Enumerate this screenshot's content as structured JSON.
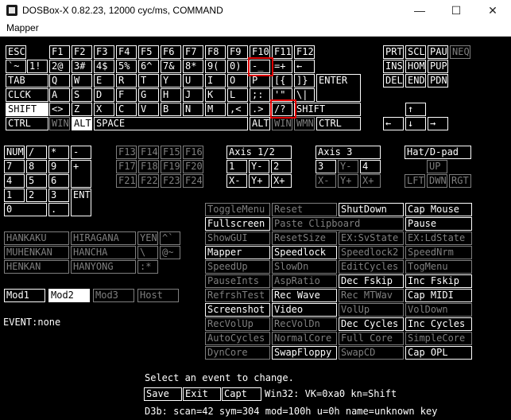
{
  "window": {
    "title": "DOSBox-X 0.82.23, 12000 cyc/ms, COMMAND",
    "minimize_glyph": "—",
    "maximize_glyph": "☐",
    "close_glyph": "✕"
  },
  "menu": [
    "Mapper"
  ],
  "keyboard": {
    "row_f": [
      "ESC",
      "F1",
      "F2",
      "F3",
      "F4",
      "F5",
      "F6",
      "F7",
      "F8",
      "F9",
      "F10",
      "F11",
      "F12"
    ],
    "row_num": [
      "`~",
      "1!",
      "2@",
      "3#",
      "4$",
      "5%",
      "6^",
      "7&",
      "8*",
      "9(",
      "0)",
      "-_",
      "=+",
      "←"
    ],
    "row_tab": [
      "TAB",
      "Q",
      "W",
      "E",
      "R",
      "T",
      "Y",
      "U",
      "I",
      "O",
      "P",
      "[{",
      "]}",
      "ENTER"
    ],
    "row_caps": [
      "CLCK",
      "A",
      "S",
      "D",
      "F",
      "G",
      "H",
      "J",
      "K",
      "L",
      ";:",
      "'\"",
      "\\|"
    ],
    "row_shift": [
      "SHIFT",
      "<>",
      "Z",
      "X",
      "C",
      "V",
      "B",
      "N",
      "M",
      ",<",
      ".>",
      "/?",
      "SHIFT"
    ],
    "row_ctrl": [
      "CTRL",
      "WIN",
      "ALT",
      "SPACE",
      "ALT",
      "WIN",
      "WMN",
      "CTRL"
    ]
  },
  "nav": {
    "row1": [
      "PRT",
      "SCL",
      "PAU",
      "NEQ"
    ],
    "row2": [
      "INS",
      "HOM",
      "PUP"
    ],
    "row3": [
      "DEL",
      "END",
      "PDN"
    ],
    "arrows": [
      "↑",
      "←",
      "↓",
      "→"
    ]
  },
  "numpad": {
    "row1": [
      "NUM",
      "/",
      "*",
      "-"
    ],
    "row2": [
      "7",
      "8",
      "9",
      "+"
    ],
    "row3": [
      "4",
      "5",
      "6"
    ],
    "row4": [
      "1",
      "2",
      "3",
      "ENT"
    ],
    "row5": [
      "0",
      "."
    ]
  },
  "fkeys_ext": [
    "F13",
    "F14",
    "F15",
    "F16",
    "F17",
    "F18",
    "F19",
    "F20",
    "F21",
    "F22",
    "F23",
    "F24"
  ],
  "axis12": {
    "title": "Axis 1/2",
    "keys": [
      "1",
      "Y-",
      "2",
      "X-",
      "Y+",
      "X+"
    ]
  },
  "axis3": {
    "title": "Axis 3",
    "keys": [
      "3",
      "Y-",
      "4",
      "X-",
      "Y+",
      "X+"
    ]
  },
  "hat": {
    "title": "Hat/D-pad",
    "keys": [
      "UP",
      "LFT",
      "DWN",
      "RGT"
    ]
  },
  "jp_keys": [
    "HANKAKU",
    "HIRAGANA",
    "YEN",
    "^`",
    "MUHENKAN",
    "HANCHA",
    "\\",
    "@~",
    "HENKAN",
    "HANYONG",
    ":*"
  ],
  "mods": [
    "Mod1",
    "Mod2",
    "Mod3",
    "Host"
  ],
  "event_status": "EVENT:none",
  "events": [
    [
      "ToggleMenu",
      "Reset",
      "ShutDown",
      "Cap Mouse"
    ],
    [
      "Fullscreen",
      "Paste Clipboard",
      "",
      "Pause"
    ],
    [
      "ShowGUI",
      "ResetSize",
      "EX:SvState",
      "EX:LdState"
    ],
    [
      "Mapper",
      "Speedlock",
      "Speedlock2",
      "SpeedNrm"
    ],
    [
      "SpeedUp",
      "SlowDn",
      "EditCycles",
      "TogMenu"
    ],
    [
      "PauseInts",
      "AspRatio",
      "Dec Fskip",
      "Inc Fskip"
    ],
    [
      "RefrshTest",
      "Rec Wave",
      "Rec MTWav",
      "Cap MIDI"
    ],
    [
      "Screenshot",
      "Video",
      "VolUp",
      "VolDown"
    ],
    [
      "RecVolUp",
      "RecVolDn",
      "Dec Cycles",
      "Inc Cycles"
    ],
    [
      "AutoCycles",
      "NormalCore",
      "Full Core",
      "SimpleCore"
    ],
    [
      "DynCore",
      "SwapFloppy",
      "SwapCD",
      "Cap OPL"
    ]
  ],
  "footer": {
    "prompt": "Select an event to change.",
    "buttons": [
      "Save",
      "Exit",
      "Capt"
    ],
    "binding": "Win32: VK=0xa0 kn=Shift",
    "d3b": "D3b: scan=42 sym=304 mod=100h u=0h name=unknown key"
  },
  "colors": {
    "background": "#000000",
    "active": "#ffffff",
    "inactive": "#7f7f7f",
    "highlight": "#e00000"
  }
}
